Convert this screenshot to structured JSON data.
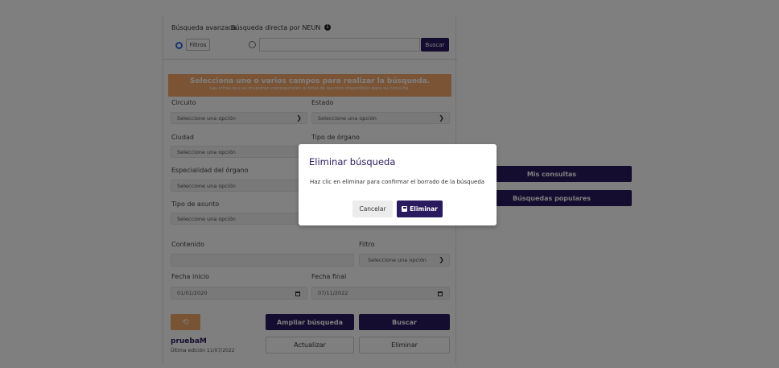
{
  "search_panel": {
    "tab_advanced": "Búsqueda avanzada",
    "tab_direct": "Búsqueda directa por NEUN",
    "info_glyph": "i",
    "filtros_label": "Filtros",
    "search_button": "Buscar",
    "search_value": ""
  },
  "banner": {
    "title": "Selecciona uno o varios campos para realizar la búsqueda.",
    "subtitle": "Las cifras que se muestran corresponden al total de asuntos disponibles para su consulta."
  },
  "fields": {
    "circuito": {
      "label": "Circuito",
      "value": "Seleccione una opción"
    },
    "estado": {
      "label": "Estado",
      "value": "Seleccione una opción"
    },
    "ciudad": {
      "label": "Ciudad",
      "value": "Seleccione una opción"
    },
    "tipo_organo": {
      "label": "Tipo de órgano"
    },
    "especialidad": {
      "label": "Especialidad del órgano",
      "value": "Seleccione una opción"
    },
    "tipo_asunto": {
      "label": "Tipo de asunto",
      "value": "Seleccione una opción"
    },
    "contenido": {
      "label": "Contenido",
      "value": ""
    },
    "filtro": {
      "label": "Filtro",
      "value": "Seleccione una opción"
    },
    "fecha_inicio": {
      "label": "Fecha inicio",
      "value": "01/01/2020"
    },
    "fecha_final": {
      "label": "Fecha final",
      "value": "07/11/2022"
    }
  },
  "actions": {
    "reset_glyph": "⟲",
    "ampliar": "Ampliar búsqueda",
    "buscar": "Buscar",
    "actualizar": "Actualizar",
    "eliminar": "Eliminar"
  },
  "saved_search": {
    "name": "pruebaM",
    "date": "Última edición 11/07/2022"
  },
  "side_buttons": {
    "mis_consultas": "Mis consultas",
    "busquedas_populares": "Búsquedas populares"
  },
  "modal": {
    "title": "Eliminar búsqueda",
    "body": "Haz clic en eliminar para confirmar el borrado de la búsqueda",
    "cancel": "Cancelar",
    "confirm": "Eliminar"
  },
  "colors": {
    "brand": "#2a1a5e",
    "accent": "#f0a86a",
    "radio": "#2f6de1"
  }
}
